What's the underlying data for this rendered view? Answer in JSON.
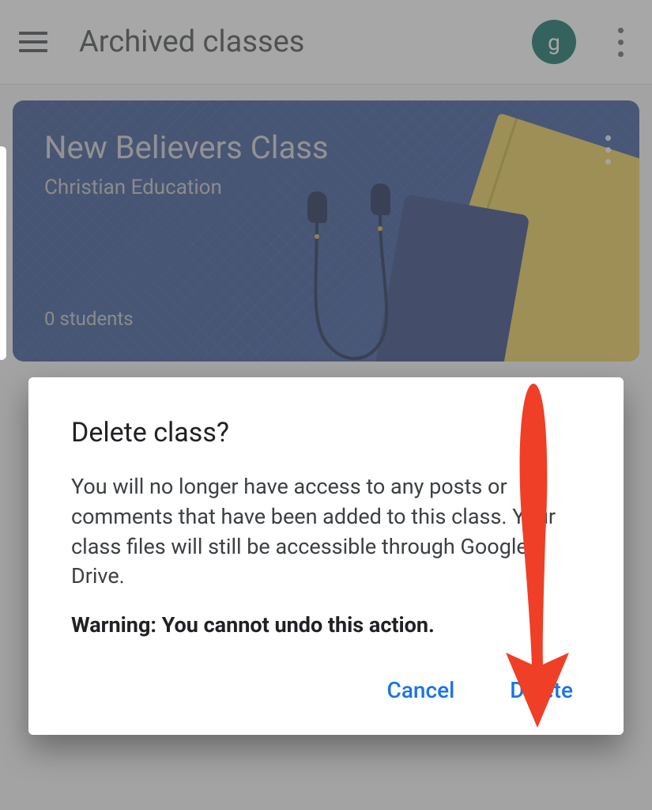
{
  "header": {
    "title": "Archived classes",
    "avatar_letter": "g"
  },
  "class_card": {
    "title": "New Believers Class",
    "subtitle": "Christian Education",
    "student_count": "0 students"
  },
  "dialog": {
    "title": "Delete class?",
    "body": "You will no longer have access to any posts or comments that have been added to this class. Your class files will still be accessible through Google Drive.",
    "warning": "Warning: You cannot undo this action.",
    "cancel_label": "Cancel",
    "delete_label": "Delete"
  },
  "colors": {
    "accent": "#1a73e8",
    "avatar_bg": "#00695c",
    "card_bg": "#2e4f99",
    "annotation": "#ef3f26"
  }
}
